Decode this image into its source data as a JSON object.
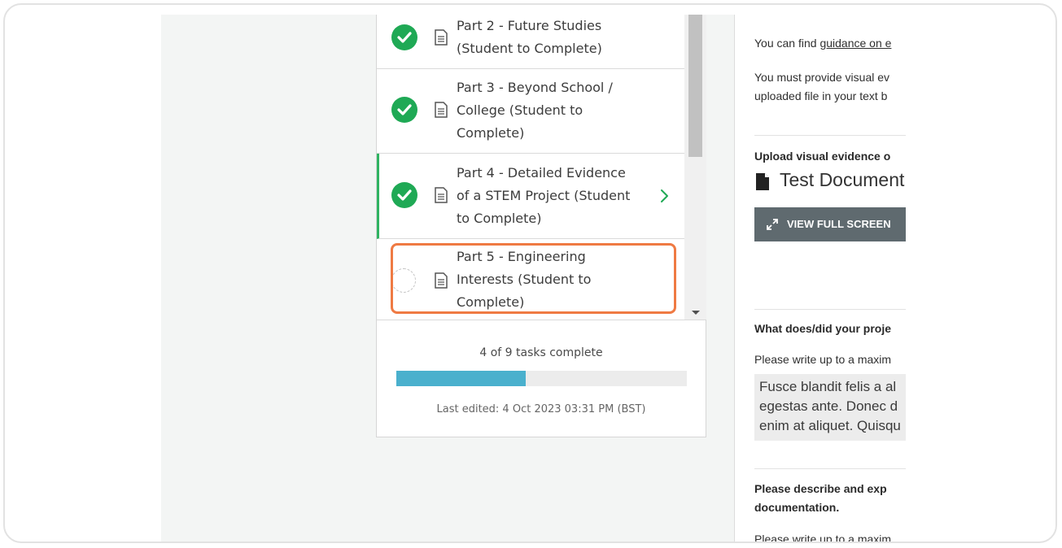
{
  "tasks": {
    "items": [
      {
        "title_line1": "Part 2 - Future Studies",
        "title_line2": "(Student to Complete)",
        "title_line3": ""
      },
      {
        "title_line1": "Part 3 - Beyond School /",
        "title_line2": "College (Student to",
        "title_line3": "Complete)"
      },
      {
        "title_line1": "Part 4 - Detailed Evidence",
        "title_line2": "of a STEM Project (Student",
        "title_line3": "to Complete)"
      },
      {
        "title_line1": "Part 5 - Engineering",
        "title_line2": "Interests (Student to",
        "title_line3": "Complete)"
      }
    ],
    "progress_text": "4 of 9 tasks complete",
    "progress_fraction": 0.444,
    "last_edited": "Last edited: 4 Oct 2023 03:31 PM (BST)"
  },
  "right_pane": {
    "guidance_prefix": "You can find ",
    "guidance_link": "guidance on e",
    "visual_line1": "You must provide visual ev",
    "visual_line2": "uploaded file in your text b",
    "upload_heading": "Upload visual evidence o",
    "document_title": "Test Document",
    "view_full_screen": "VIEW FULL SCREEN",
    "question1_heading": "What does/did your proje",
    "question1_hint": "Please write up to a maxim",
    "answer_line1": "Fusce blandit felis a al",
    "answer_line2": "egestas ante. Donec d",
    "answer_line3": "enim at aliquet. Quisqu",
    "question2_line1": "Please describe and exp",
    "question2_line2": "documentation.",
    "question2_hint": "Please write up to a maxim"
  },
  "colors": {
    "complete_green": "#1fa955",
    "active_border": "#2fb361",
    "highlight_orange": "#ef7a43",
    "progress_blue": "#4ab0cd",
    "button_grey": "#5f6a6f"
  }
}
